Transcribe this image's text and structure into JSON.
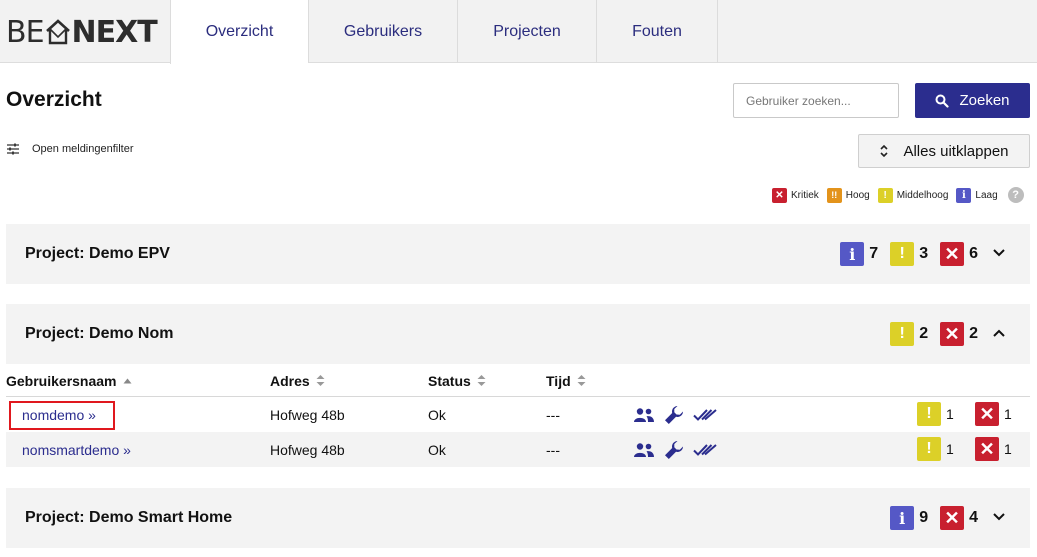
{
  "logo": {
    "part1": "BE",
    "part2": "NEXT"
  },
  "nav": {
    "tabs": [
      "Overzicht",
      "Gebruikers",
      "Projecten",
      "Fouten"
    ]
  },
  "page": {
    "title": "Overzicht"
  },
  "search": {
    "placeholder": "Gebruiker zoeken...",
    "button": "Zoeken"
  },
  "filter": {
    "label": "Open meldingenfilter"
  },
  "expand": {
    "label": "Alles uitklappen"
  },
  "legend": {
    "kritiek": "Kritiek",
    "hoog": "Hoog",
    "middelhoog": "Middelhoog",
    "laag": "Laag",
    "help": "?"
  },
  "colors": {
    "info": "#5558c6",
    "warning": "#dcd028",
    "critical": "#c8202f",
    "high": "#e3931b",
    "accent": "#2b2d8e"
  },
  "projects": [
    {
      "title": "Project: Demo EPV",
      "counts": {
        "info": "7",
        "warning": "3",
        "critical": "6"
      }
    },
    {
      "title": "Project: Demo Nom",
      "counts": {
        "warning": "2",
        "critical": "2"
      }
    },
    {
      "title": "Project: Demo Smart Home",
      "counts": {
        "info": "9",
        "critical": "4"
      }
    }
  ],
  "table": {
    "headers": {
      "username": "Gebruikersnaam",
      "address": "Adres",
      "status": "Status",
      "time": "Tijd"
    },
    "rows": [
      {
        "username": "nomdemo »",
        "address": "Hofweg 48b",
        "status": "Ok",
        "time": "---",
        "warning": "1",
        "critical": "1"
      },
      {
        "username": "nomsmartdemo »",
        "address": "Hofweg 48b",
        "status": "Ok",
        "time": "---",
        "warning": "1",
        "critical": "1"
      }
    ]
  }
}
